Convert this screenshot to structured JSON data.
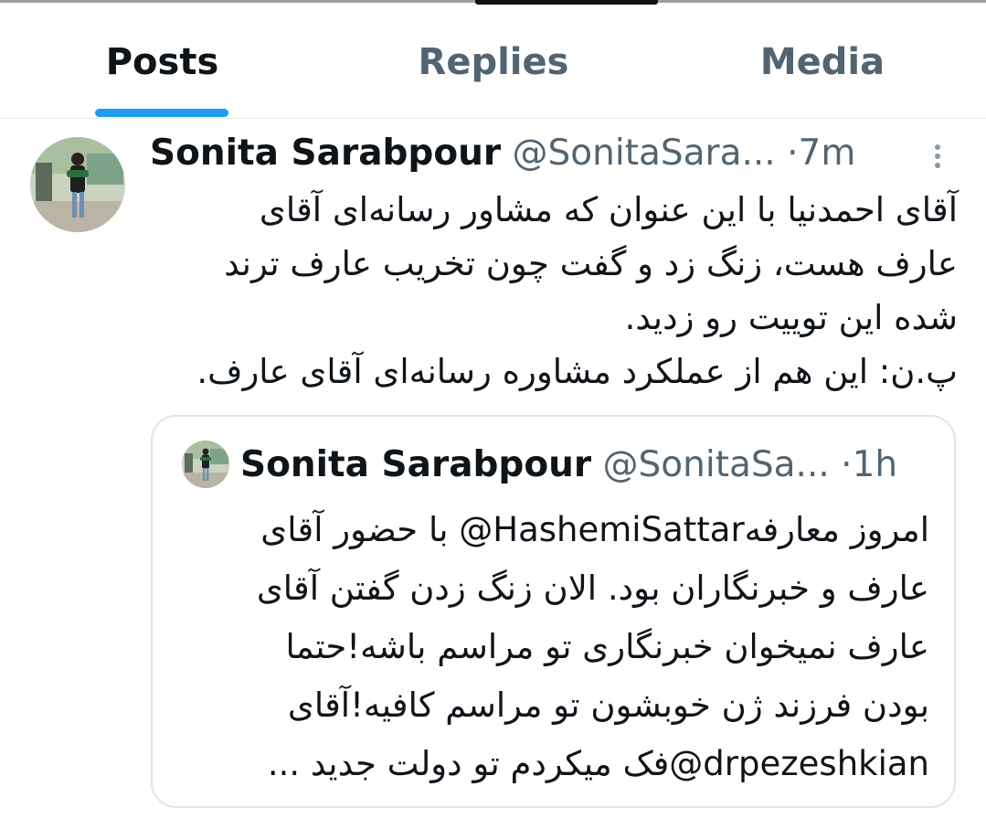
{
  "tabs": [
    {
      "label": "Posts",
      "active": true
    },
    {
      "label": "Replies",
      "active": false
    },
    {
      "label": "Media",
      "active": false
    }
  ],
  "post": {
    "author_name": "Sonita Sarabpour",
    "handle": "@SonitaSara...",
    "separator": "·",
    "time": "7m",
    "lines": [
      "آقای احمدنیا با این عنوان که مشاور رسانه‌ای آقای",
      "عارف هست، زنگ زد و گفت چون تخریب عارف ترند",
      "شده این توییت رو زدید.",
      "پ.ن: این هم از عملکرد مشاوره رسانه‌ای آقای عارف."
    ]
  },
  "quoted": {
    "author_name": "Sonita Sarabpour",
    "handle": "@SonitaSa...",
    "separator": "·",
    "time": "1h",
    "lines": [
      "امروز معارفه‎@HashemiSattar‎ با حضور آقای",
      "عارف و خبرنگاران بود. الان زنگ زدن گفتن آقای",
      "عارف نمیخوان خبرنگاری تو مراسم باشه!حتما",
      "بودن فرزند ژن خوبشون تو مراسم کافیه!آقای",
      "‎@drpezeshkian‎فک میکردم تو دولت جدید ..."
    ]
  },
  "colors": {
    "accent": "#1d9bf0",
    "text_primary": "#0f1419",
    "text_secondary": "#536471",
    "border": "#dfe5ea"
  }
}
